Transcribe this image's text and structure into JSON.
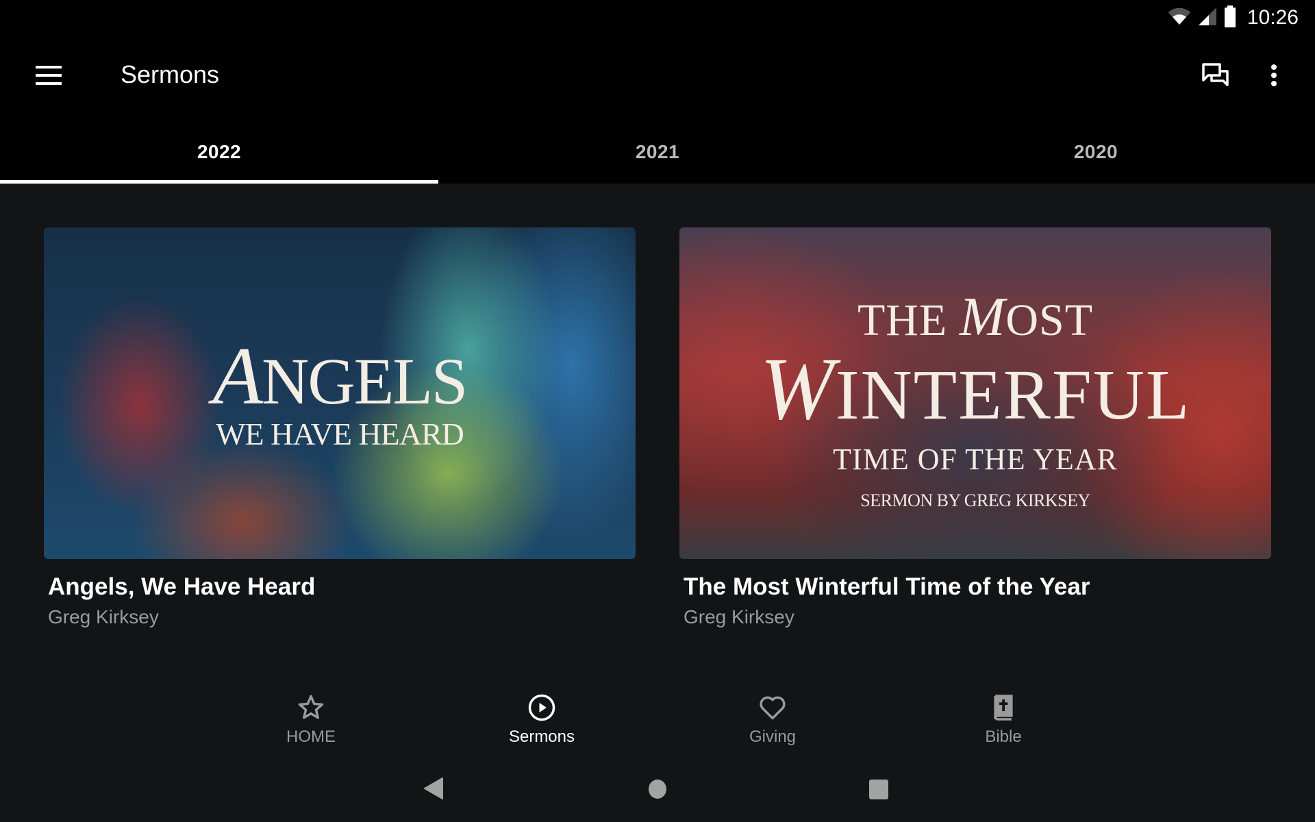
{
  "status_bar": {
    "time": "10:26",
    "icons": [
      "wifi-icon",
      "cell-signal-icon",
      "battery-icon"
    ]
  },
  "app_bar": {
    "title": "Sermons",
    "menu_icon": "hamburger-menu-icon",
    "actions": [
      "chat-icon",
      "more-vert-icon"
    ]
  },
  "tabs": [
    {
      "label": "2022",
      "active": true
    },
    {
      "label": "2021",
      "active": false
    },
    {
      "label": "2020",
      "active": false
    }
  ],
  "sermons": [
    {
      "title": "Angels, We Have Heard",
      "speaker": "Greg Kirksey",
      "artwork": {
        "line1_script": "A",
        "line1_rest": "NGELS",
        "line2": "WE HAVE HEARD"
      }
    },
    {
      "title": "The Most Winterful Time of the Year",
      "speaker": "Greg Kirksey",
      "artwork": {
        "line1_a": "THE ",
        "line1_script": "M",
        "line1_b": "OST",
        "line2_script": "W",
        "line2_rest": "INTERFUL",
        "line3": "TIME OF THE YEAR",
        "line4": "SERMON BY GREG KIRKSEY"
      }
    }
  ],
  "bottom_nav": [
    {
      "label": "HOME",
      "icon": "star-icon",
      "active": false
    },
    {
      "label": "Sermons",
      "icon": "play-circle-icon",
      "active": true
    },
    {
      "label": "Giving",
      "icon": "heart-icon",
      "active": false
    },
    {
      "label": "Bible",
      "icon": "bible-icon",
      "active": false
    }
  ],
  "system_nav": [
    "back-icon",
    "home-icon",
    "recents-icon"
  ],
  "colors": {
    "background": "#131416",
    "topbar": "#000000",
    "active_text": "#ffffff",
    "inactive_text": "#9a9a9a",
    "subtitle": "#9b9b9b"
  }
}
